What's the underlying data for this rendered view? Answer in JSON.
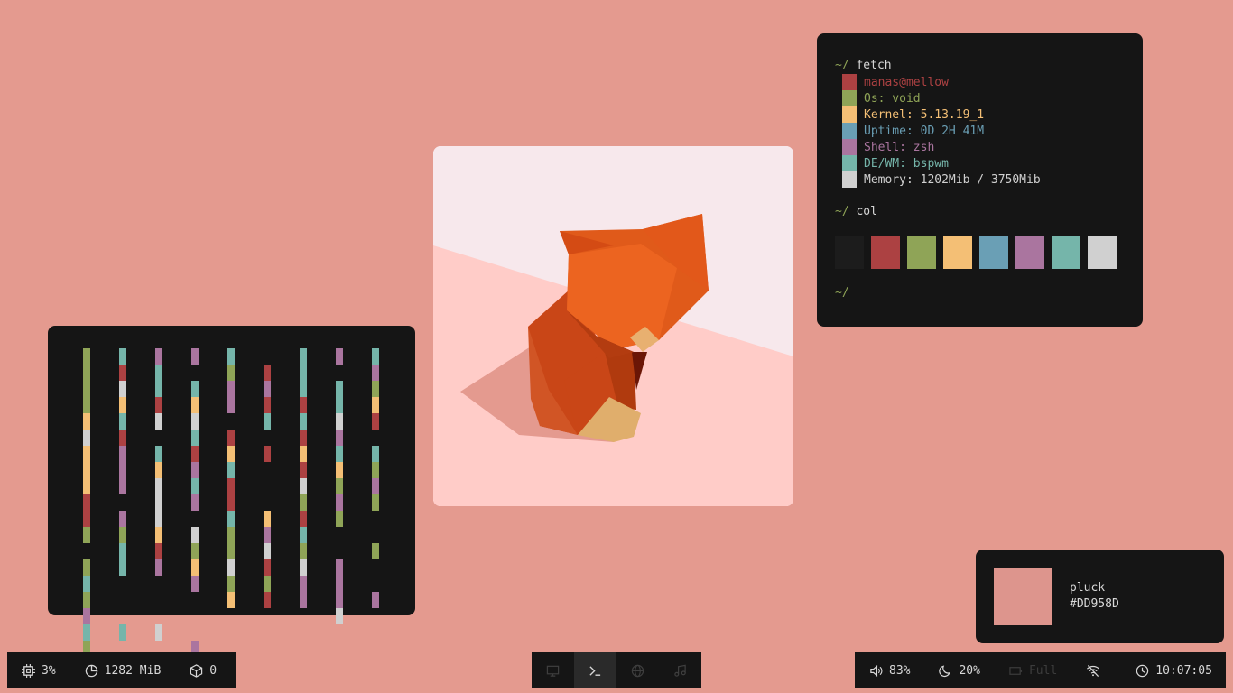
{
  "terminal": {
    "prompt": "~/",
    "cmd1": "fetch",
    "info": [
      {
        "text": "manas@mellow",
        "color": "#AC4142"
      },
      {
        "text": "Os: void",
        "color": "#8FA457"
      },
      {
        "text": "Kernel: 5.13.19_1",
        "color": "#F4BF75"
      },
      {
        "text": "Uptime: 0D 2H 41M",
        "color": "#6A9FB5"
      },
      {
        "text": "Shell: zsh",
        "color": "#AA759F"
      },
      {
        "text": "DE/WM: bspwm",
        "color": "#75B5AA"
      },
      {
        "text": "Memory: 1202Mib / 3750Mib",
        "color": "#D0D0D0"
      }
    ],
    "cmd2": "col",
    "palette": [
      "#151515",
      "#AC4142",
      "#8FA457",
      "#F4BF75",
      "#6A9FB5",
      "#AA759F",
      "#75B5AA",
      "#D0D0D0"
    ]
  },
  "picker": {
    "name": "pluck",
    "hex": "#DD958D",
    "color": "#DD958D"
  },
  "bar": {
    "cpu": "3%",
    "memory": "1282 MiB",
    "updates": "0",
    "volume": "83%",
    "brightness": "20%",
    "battery": "Full",
    "time": "10:07:05"
  },
  "workspaces": [
    {
      "icon": "monitor-icon",
      "active": false
    },
    {
      "icon": "terminal-icon",
      "active": true
    },
    {
      "icon": "globe-icon",
      "active": false
    },
    {
      "icon": "music-icon",
      "active": false
    }
  ]
}
